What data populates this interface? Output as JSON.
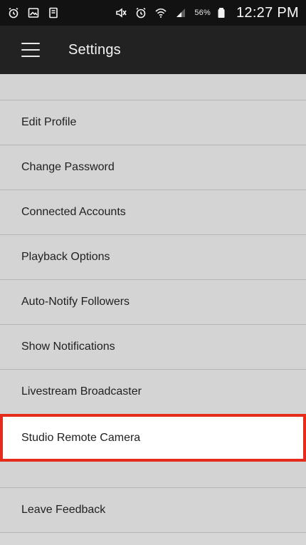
{
  "status_bar": {
    "icons_left": [
      "alarm-clock-icon",
      "image-icon",
      "notification-icon"
    ],
    "icons_right": [
      "mute-icon",
      "alarm-icon",
      "wifi-icon",
      "signal-icon",
      "battery-icon"
    ],
    "battery_percent": "56%",
    "time": "12:27 PM"
  },
  "app_bar": {
    "title": "Settings",
    "menu_icon": "hamburger-menu-icon"
  },
  "settings": {
    "items": [
      {
        "label": "Edit Profile"
      },
      {
        "label": "Change Password"
      },
      {
        "label": "Connected Accounts"
      },
      {
        "label": "Playback Options"
      },
      {
        "label": "Auto-Notify Followers"
      },
      {
        "label": "Show Notifications"
      },
      {
        "label": "Livestream Broadcaster"
      },
      {
        "label": "Studio Remote Camera",
        "highlighted": true
      },
      {
        "label": "Leave Feedback"
      }
    ]
  },
  "colors": {
    "status_bar_bg": "#121212",
    "app_bar_bg": "#222222",
    "list_bg": "#d4d4d4",
    "highlight_border": "#e52b1b",
    "highlight_bg": "#ffffff"
  }
}
